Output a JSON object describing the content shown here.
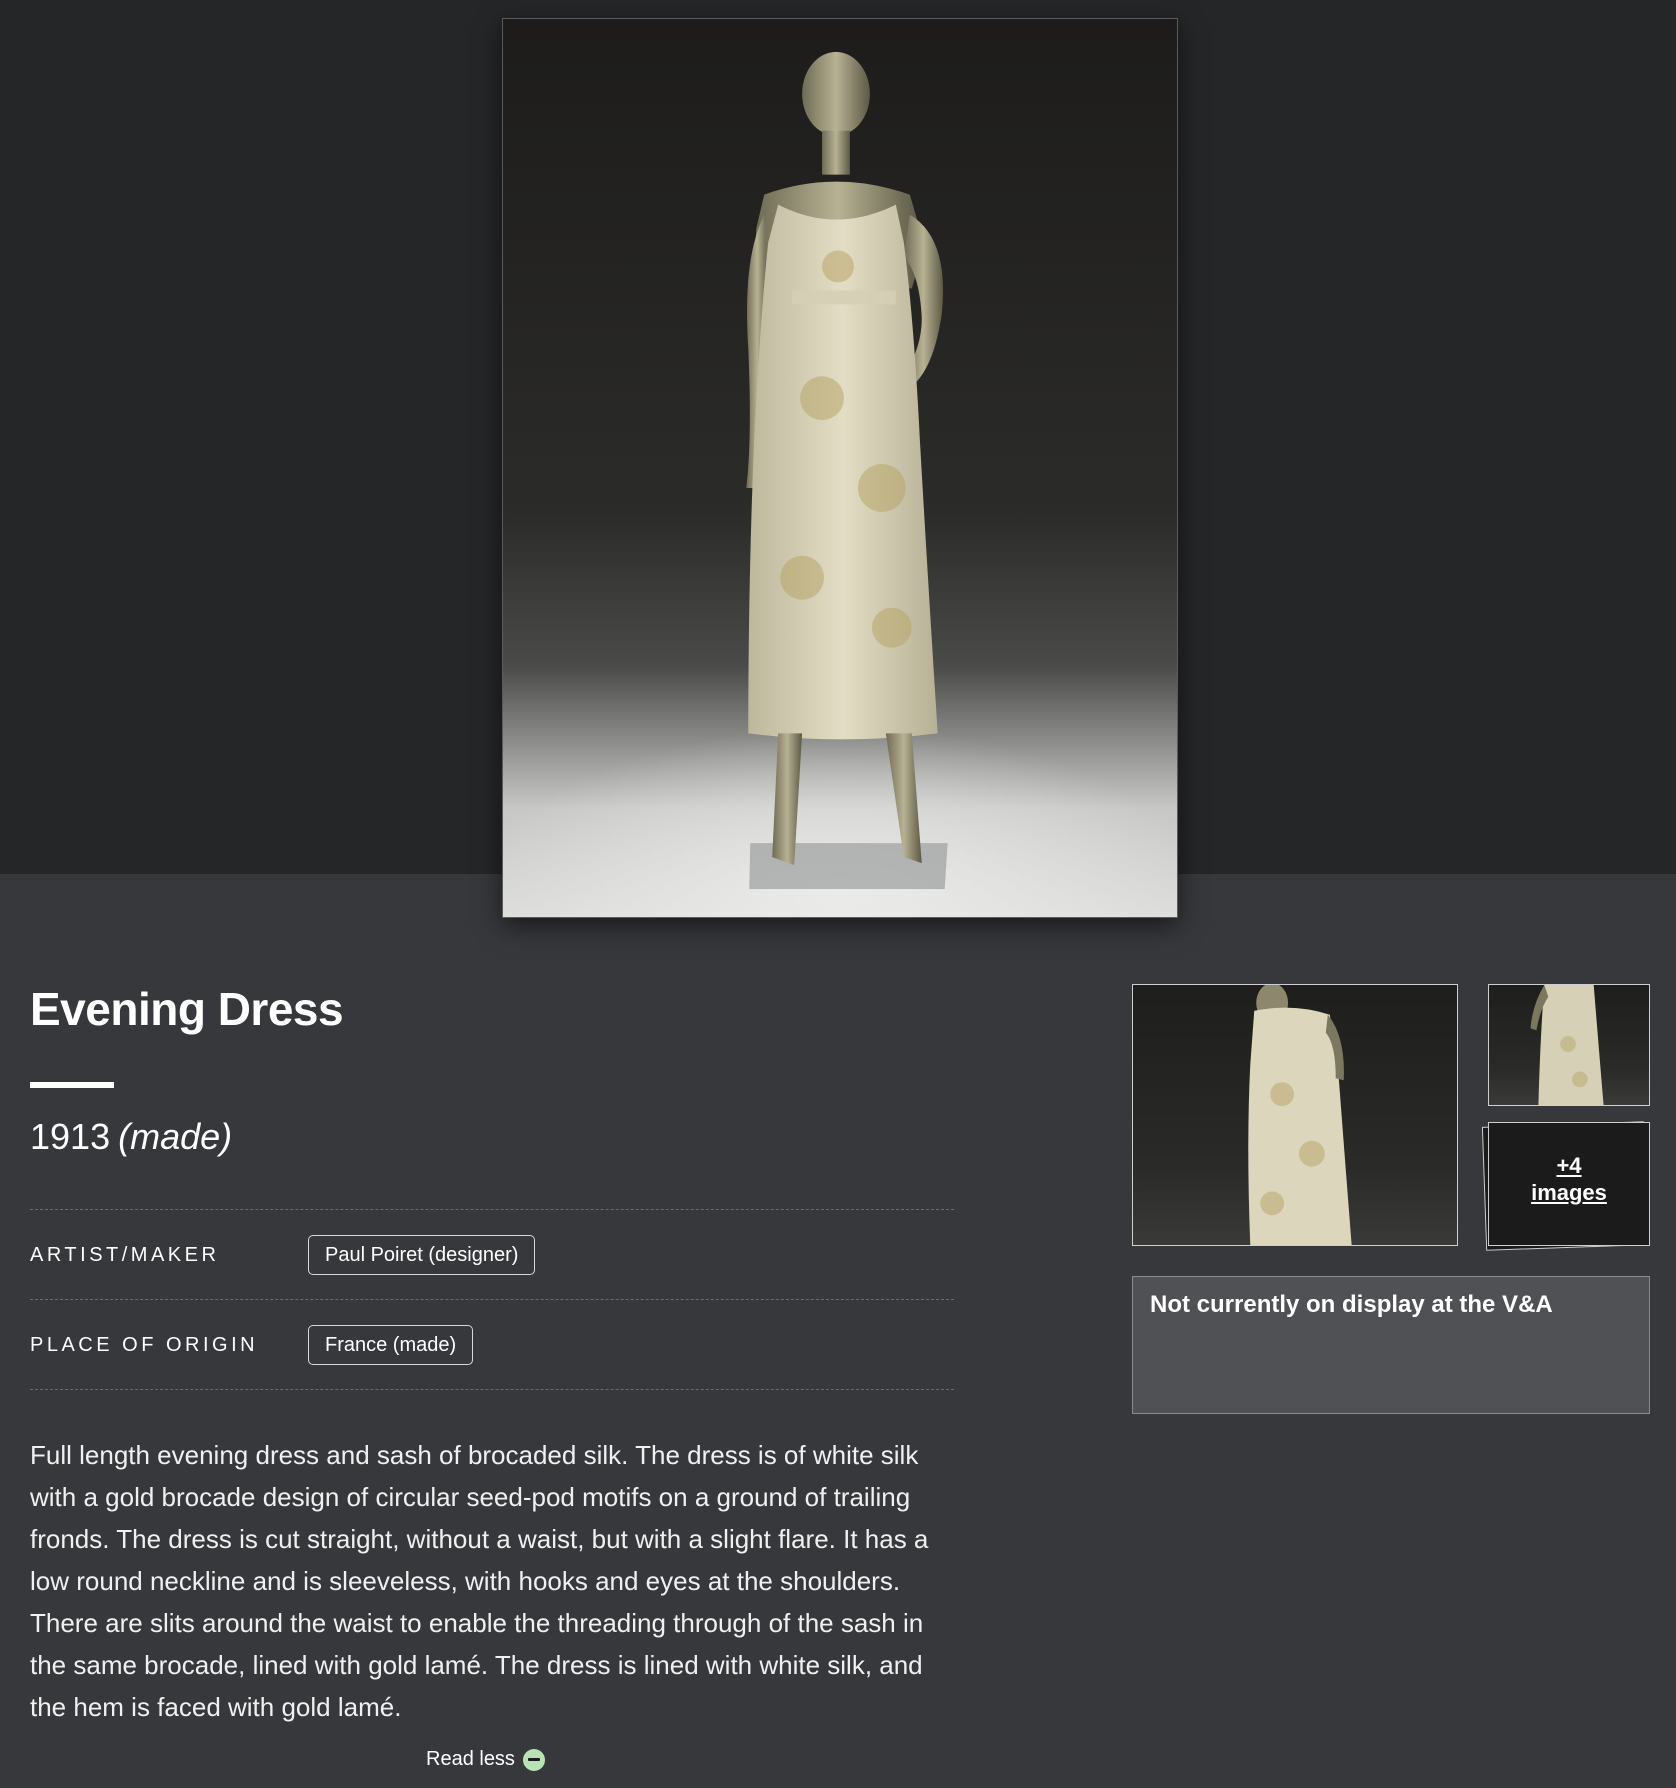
{
  "object": {
    "title": "Evening Dress",
    "date": "1913",
    "date_qualifier": "(made)"
  },
  "metadata": [
    {
      "label": "ARTIST/MAKER",
      "value": "Paul Poiret (designer)"
    },
    {
      "label": "PLACE OF ORIGIN",
      "value": "France (made)"
    }
  ],
  "description": "Full length evening dress and sash of brocaded silk. The dress is of white silk with a gold brocade design of circular seed-pod motifs on a ground of trailing fronds. The dress is cut straight, without a waist, but with a slight flare. It has a low round neckline and is sleeveless, with hooks and eyes at the shoulders. There are slits around the waist to enable the threading through of the sash in the same brocade, lined with gold lamé. The dress is lined with white silk, and the hem is faced with gold lamé.",
  "read_less_label": "Read less",
  "gallery": {
    "more_count": "+4",
    "more_label": "images"
  },
  "display_status": "Not currently on display at the V&A",
  "colors": {
    "page_bg": "#37383c",
    "hero_bg": "#252627",
    "status_bg": "#505154",
    "accent_icon": "#b9e3b4"
  }
}
